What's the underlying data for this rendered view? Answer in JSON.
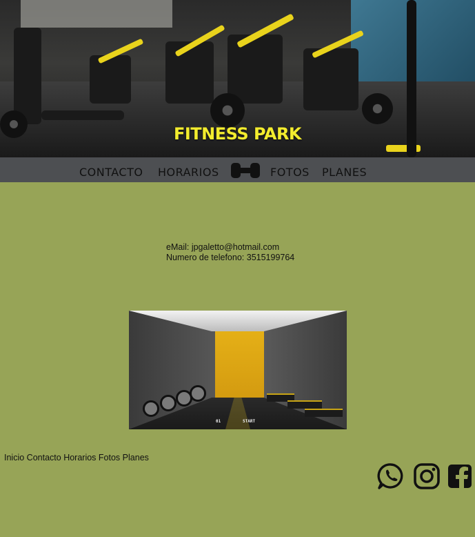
{
  "hero": {
    "title": "FITNESS PARK"
  },
  "nav": {
    "items": [
      {
        "label": "CONTACTO"
      },
      {
        "label": "HORARIOS"
      },
      {
        "label": "FOTOS"
      },
      {
        "label": "PLANES"
      }
    ],
    "logo_icon": "dumbbell-icon"
  },
  "contact": {
    "email_line": "eMail: jpgaletto@hotmail.com",
    "phone_line": "Numero de telefono: 3515199764"
  },
  "photo": {
    "floor_text_1": "01",
    "floor_text_2": "START"
  },
  "footer": {
    "links": [
      "Inicio",
      "Contacto",
      "Horarios",
      "Fotos",
      "Planes"
    ],
    "social_icons": [
      "whatsapp-icon",
      "instagram-icon",
      "facebook-icon"
    ]
  },
  "colors": {
    "page_background": "#97a457",
    "nav_background": "#4d4f52",
    "title_yellow": "#f3ec2e"
  }
}
